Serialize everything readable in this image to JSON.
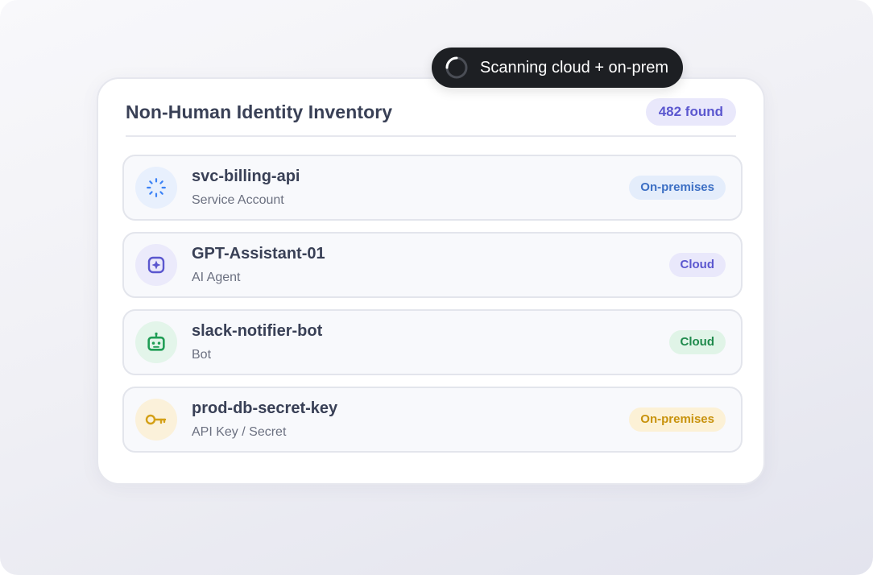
{
  "status": {
    "text": "Scanning cloud + on-prem",
    "spinner_icon": "spinner-icon"
  },
  "inventory": {
    "title": "Non-Human Identity Inventory",
    "found_badge": "482 found",
    "items": [
      {
        "name": "svc-billing-api",
        "type": "Service Account",
        "location": "On-premises",
        "icon": "loader-icon",
        "icon_color": "#3b82f6",
        "icon_bg": "#e8f0fd",
        "badge_bg": "#e4edfb",
        "badge_color": "#3c6fc4"
      },
      {
        "name": "GPT-Assistant-01",
        "type": "AI Agent",
        "location": "Cloud",
        "icon": "ai-chip-icon",
        "icon_color": "#5b57cf",
        "icon_bg": "#ebeafb",
        "badge_bg": "#e9e8fb",
        "badge_color": "#5b57cf"
      },
      {
        "name": "slack-notifier-bot",
        "type": "Bot",
        "location": "Cloud",
        "icon": "robot-icon",
        "icon_color": "#1f9d55",
        "icon_bg": "#e3f5ea",
        "badge_bg": "#e0f4e7",
        "badge_color": "#1f8a4c"
      },
      {
        "name": "prod-db-secret-key",
        "type": "API Key / Secret",
        "location": "On-premises",
        "icon": "key-icon",
        "icon_color": "#d4a017",
        "icon_bg": "#fbf1da",
        "badge_bg": "#fcf1d6",
        "badge_color": "#c8920c"
      }
    ]
  }
}
